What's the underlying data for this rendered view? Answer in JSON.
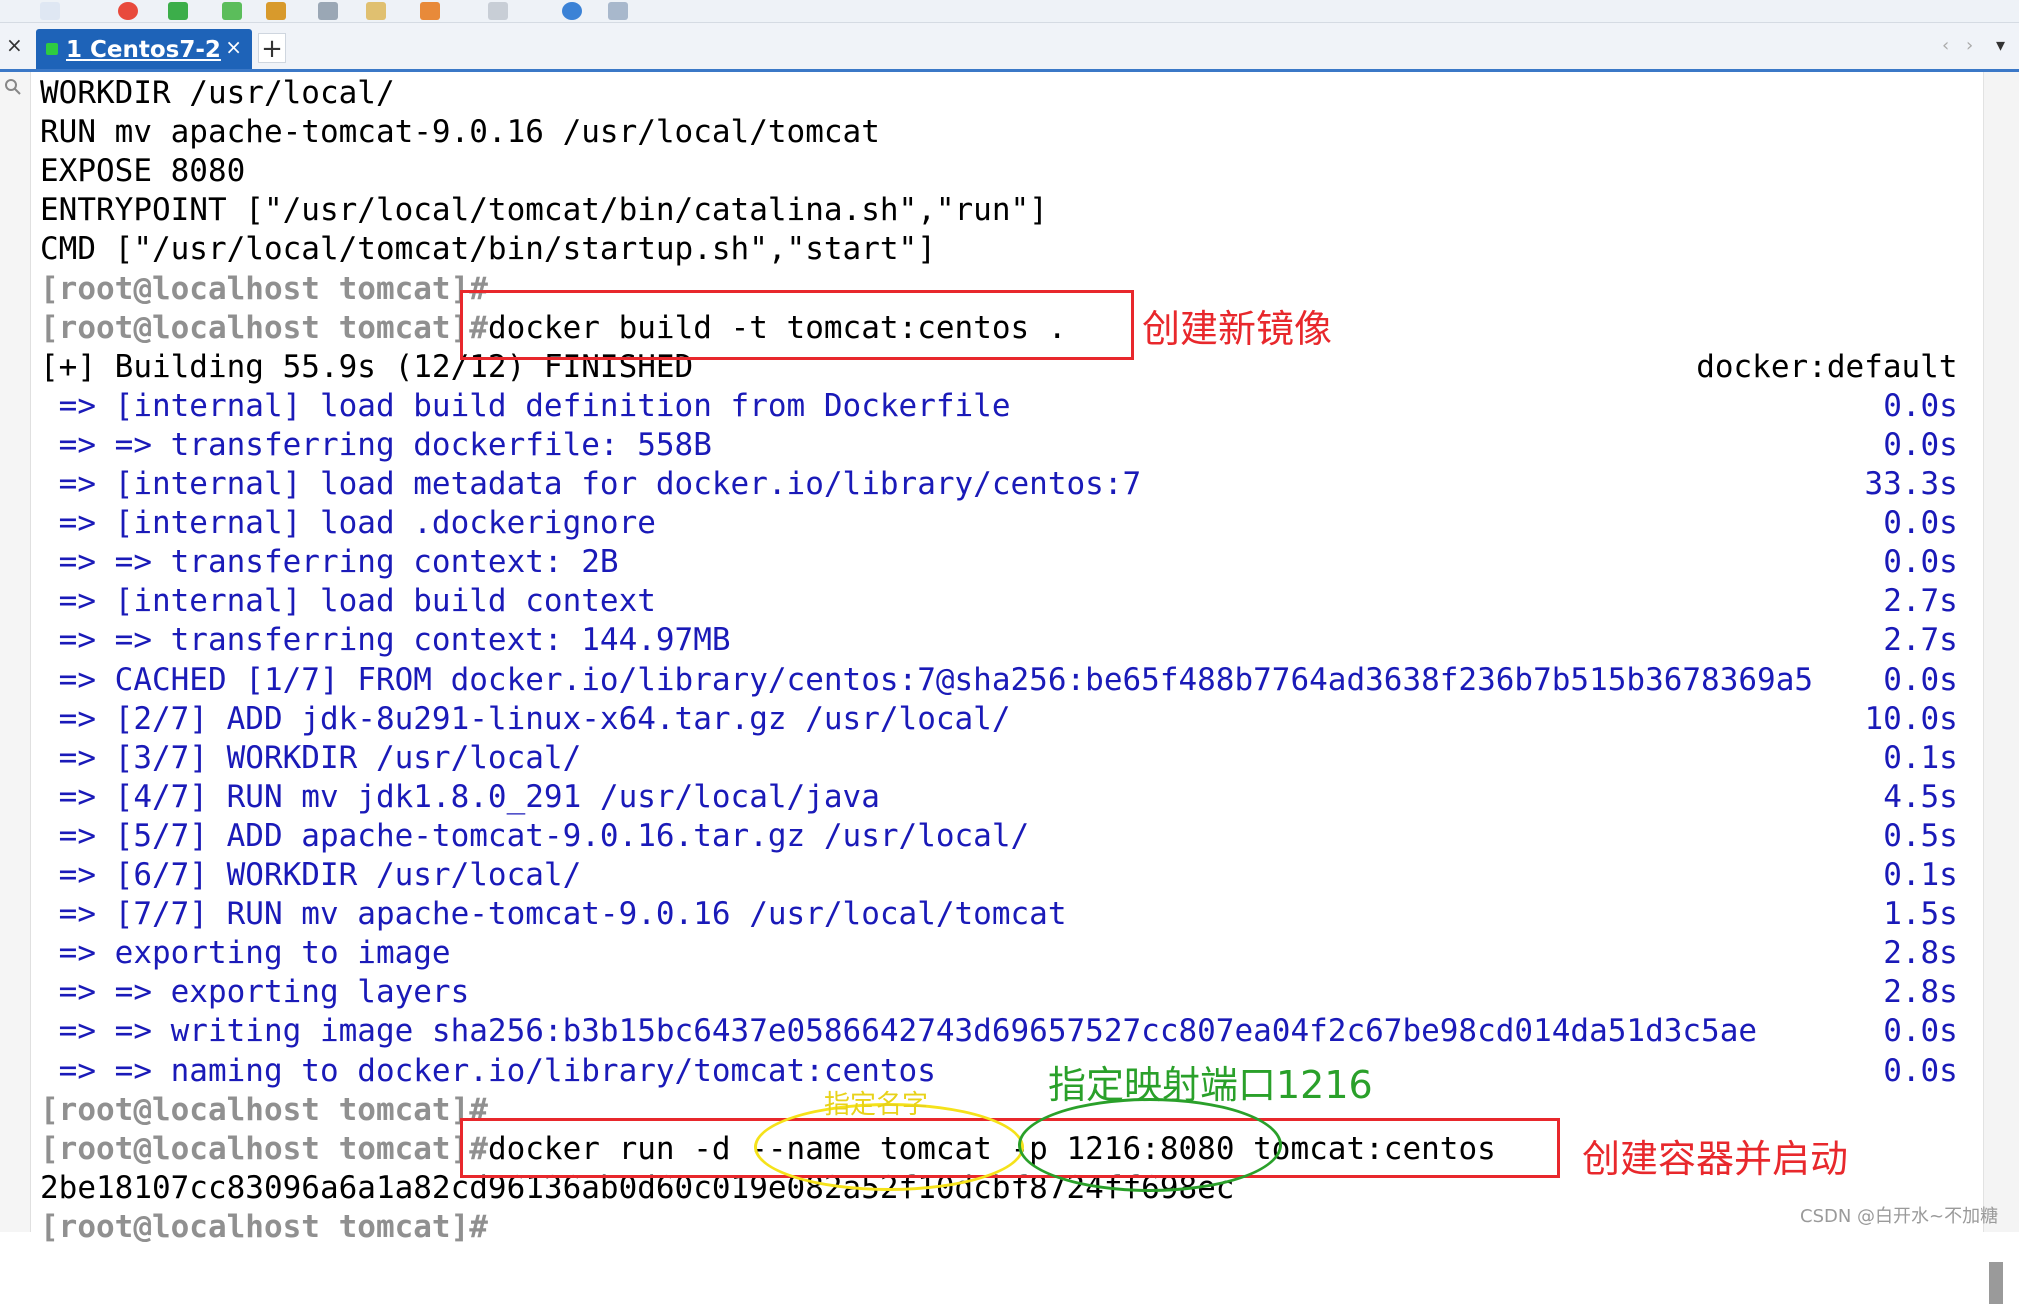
{
  "tab": {
    "number": "1",
    "label": "Centos7-2",
    "close": "×",
    "add": "+",
    "close_all": "×"
  },
  "tab_nav": [
    "‹",
    "›",
    "▾"
  ],
  "terminal": {
    "lines": [
      {
        "parts": [
          {
            "t": "WORKDIR /usr/local/",
            "c": "plain"
          }
        ]
      },
      {
        "parts": [
          {
            "t": "RUN mv apache-tomcat-9.0.16 /usr/local/tomcat",
            "c": "plain"
          }
        ]
      },
      {
        "parts": [
          {
            "t": "EXPOSE 8080",
            "c": "plain"
          }
        ]
      },
      {
        "parts": [
          {
            "t": "ENTRYPOINT [\"/usr/local/tomcat/bin/catalina.sh\",\"run\"]",
            "c": "plain"
          }
        ]
      },
      {
        "parts": [
          {
            "t": "CMD [\"/usr/local/tomcat/bin/startup.sh\",\"start\"]",
            "c": "plain"
          }
        ]
      },
      {
        "parts": [
          {
            "t": "[root@localhost tomcat]#",
            "c": "prompt"
          }
        ]
      },
      {
        "parts": [
          {
            "t": "[root@localhost tomcat]#",
            "c": "prompt"
          },
          {
            "t": "docker build -t tomcat:centos .",
            "c": "plain"
          }
        ]
      },
      {
        "parts": [
          {
            "t": "[+] Building 55.9s (12/12) FINISHED",
            "c": "plain"
          }
        ],
        "time": "docker:default",
        "time_class": "plain"
      },
      {
        "parts": [
          {
            "t": " => [internal] load build definition from Dockerfile",
            "c": "blue"
          }
        ],
        "time": "0.0s"
      },
      {
        "parts": [
          {
            "t": " => => transferring dockerfile: 558B",
            "c": "blue"
          }
        ],
        "time": "0.0s"
      },
      {
        "parts": [
          {
            "t": " => [internal] load metadata for docker.io/library/centos:7",
            "c": "blue"
          }
        ],
        "time": "33.3s"
      },
      {
        "parts": [
          {
            "t": " => [internal] load .dockerignore",
            "c": "blue"
          }
        ],
        "time": "0.0s"
      },
      {
        "parts": [
          {
            "t": " => => transferring context: 2B",
            "c": "blue"
          }
        ],
        "time": "0.0s"
      },
      {
        "parts": [
          {
            "t": " => [internal] load build context",
            "c": "blue"
          }
        ],
        "time": "2.7s"
      },
      {
        "parts": [
          {
            "t": " => => transferring context: 144.97MB",
            "c": "blue"
          }
        ],
        "time": "2.7s"
      },
      {
        "parts": [
          {
            "t": " => CACHED [1/7] FROM docker.io/library/centos:7@sha256:be65f488b7764ad3638f236b7b515b3678369a5",
            "c": "blue"
          }
        ],
        "time": "0.0s"
      },
      {
        "parts": [
          {
            "t": " => [2/7] ADD jdk-8u291-linux-x64.tar.gz /usr/local/",
            "c": "blue"
          }
        ],
        "time": "10.0s"
      },
      {
        "parts": [
          {
            "t": " => [3/7] WORKDIR /usr/local/",
            "c": "blue"
          }
        ],
        "time": "0.1s"
      },
      {
        "parts": [
          {
            "t": " => [4/7] RUN mv jdk1.8.0_291 /usr/local/java",
            "c": "blue"
          }
        ],
        "time": "4.5s"
      },
      {
        "parts": [
          {
            "t": " => [5/7] ADD apache-tomcat-9.0.16.tar.gz /usr/local/",
            "c": "blue"
          }
        ],
        "time": "0.5s"
      },
      {
        "parts": [
          {
            "t": " => [6/7] WORKDIR /usr/local/",
            "c": "blue"
          }
        ],
        "time": "0.1s"
      },
      {
        "parts": [
          {
            "t": " => [7/7] RUN mv apache-tomcat-9.0.16 /usr/local/tomcat",
            "c": "blue"
          }
        ],
        "time": "1.5s"
      },
      {
        "parts": [
          {
            "t": " => exporting to image",
            "c": "blue"
          }
        ],
        "time": "2.8s"
      },
      {
        "parts": [
          {
            "t": " => => exporting layers",
            "c": "blue"
          }
        ],
        "time": "2.8s"
      },
      {
        "parts": [
          {
            "t": " => => writing image sha256:b3b15bc6437e0586642743d69657527cc807ea04f2c67be98cd014da51d3c5ae",
            "c": "blue"
          }
        ],
        "time": "0.0s"
      },
      {
        "parts": [
          {
            "t": " => => naming to docker.io/library/tomcat:centos",
            "c": "blue"
          }
        ],
        "time": "0.0s"
      },
      {
        "parts": [
          {
            "t": "[root@localhost tomcat]#",
            "c": "prompt"
          }
        ]
      },
      {
        "parts": [
          {
            "t": "[root@localhost tomcat]#",
            "c": "prompt"
          },
          {
            "t": "docker run -d --name tomcat -p 1216:8080 tomcat:centos",
            "c": "plain"
          }
        ]
      },
      {
        "parts": [
          {
            "t": "2be18107cc83096a6a1a82cd96136ab0d60c019e082a52f10dcbf8724ff698ec",
            "c": "plain"
          }
        ]
      },
      {
        "parts": [
          {
            "t": "[root@localhost tomcat]#",
            "c": "prompt"
          }
        ]
      }
    ]
  },
  "annotations": {
    "build_image": "创建新镜像",
    "port_mapping": "指定映射端口1216",
    "container_name": "指定名字",
    "create_start": "创建容器并启动"
  },
  "watermark": "CSDN @白开水~不加糖",
  "colors": {
    "annotation_red": "#e8282c",
    "annotation_green": "#2aa02a",
    "annotation_yellow": "#f5e21a",
    "output_blue": "#1a1ab8",
    "prompt_gray": "#909090",
    "tab_blue": "#1e63b8"
  }
}
